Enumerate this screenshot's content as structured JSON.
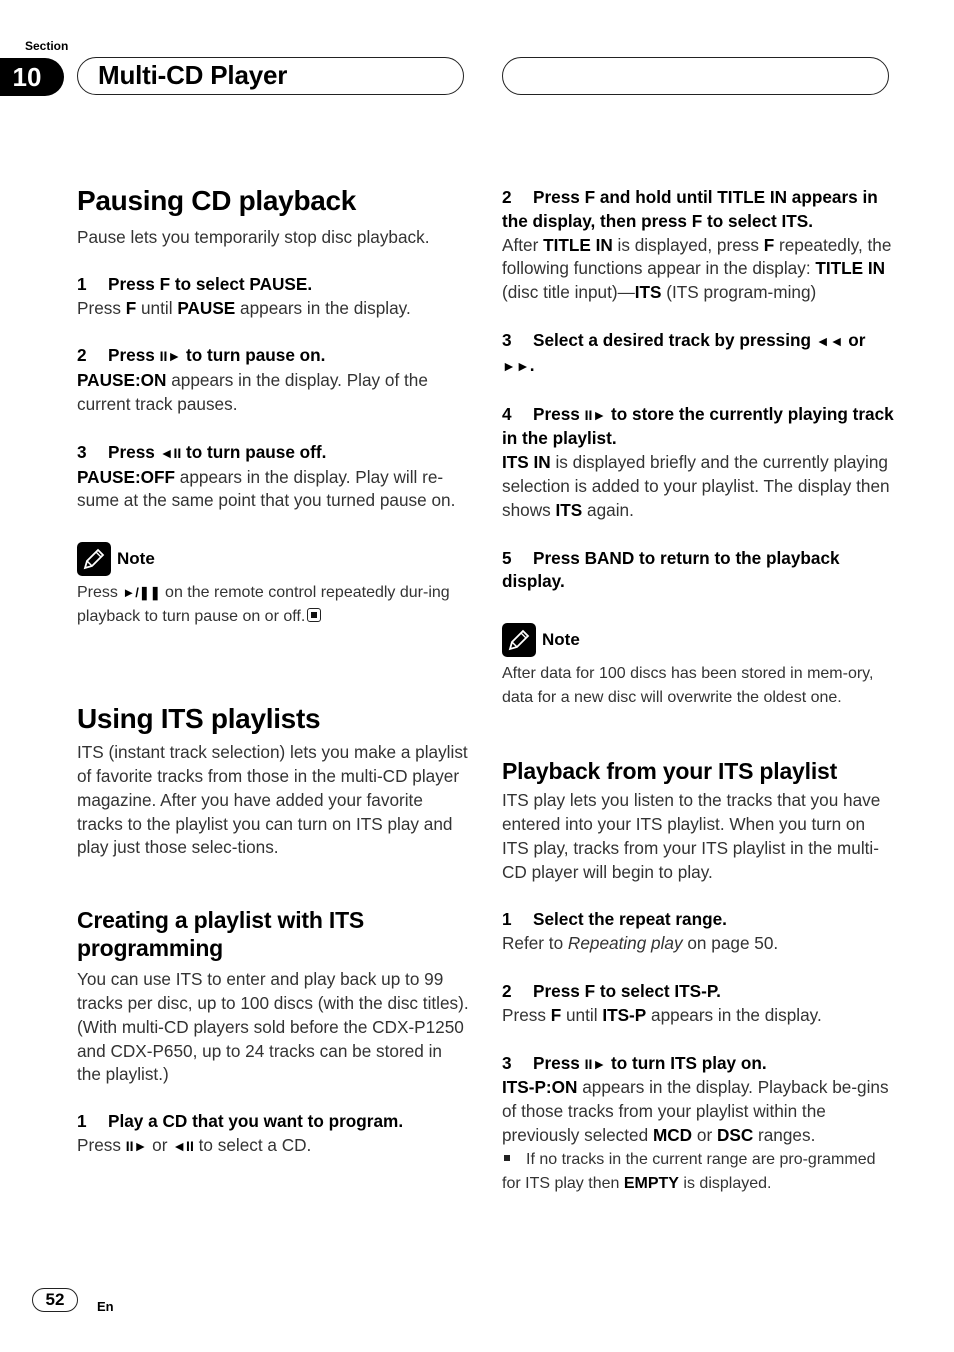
{
  "header": {
    "section_label": "Section",
    "section_number": "10",
    "title": "Multi-CD Player"
  },
  "left": {
    "pausing": {
      "title": "Pausing CD playback",
      "intro": "Pause lets you temporarily stop disc playback.",
      "step1": {
        "num": "1",
        "title": "Press F to select PAUSE.",
        "b_pre": "Press ",
        "b1": "F",
        "b_mid": " until ",
        "b2": "PAUSE",
        "b_post": " appears in the display."
      },
      "step2": {
        "num": "2",
        "t_pre": "Press ",
        "icon": "II►",
        "t_post": " to turn pause on.",
        "b1": "PAUSE:ON",
        "b_post": " appears in the display. Play of the current track pauses."
      },
      "step3": {
        "num": "3",
        "t_pre": "Press ",
        "icon": "◄II",
        "t_post": " to turn pause off.",
        "b1": "PAUSE:OFF",
        "b_post": " appears in the display. Play will re-sume at the same point that you turned pause on."
      },
      "note": {
        "label": "Note",
        "pre": "Press ",
        "icon": "►/❚❚",
        "post": " on the remote control repeatedly dur-ing playback to turn pause on or off."
      }
    },
    "its": {
      "title": "Using ITS playlists",
      "intro": "ITS (instant track selection) lets you make a playlist of favorite tracks from those in the multi-CD player magazine. After you have added your favorite tracks to the playlist you can turn on ITS play and play just those selec-tions."
    },
    "creating": {
      "title": "Creating a playlist with ITS programming",
      "intro": "You can use ITS to enter and play back up to 99 tracks per disc, up to 100 discs (with the disc titles). (With multi-CD players sold before the CDX-P1250 and CDX-P650, up to 24 tracks can be stored in the playlist.)",
      "step1": {
        "num": "1",
        "title": "Play a CD that you want to program.",
        "pre": "Press ",
        "icon1": "II►",
        "mid": " or ",
        "icon2": "◄II",
        "post": " to select a CD."
      }
    }
  },
  "right": {
    "step2": {
      "num": "2",
      "title": "Press F and hold until TITLE IN appears in the display, then press F to select ITS.",
      "p1": "After ",
      "b1": "TITLE IN",
      "p2": " is displayed, press ",
      "b2": "F",
      "p3": " repeatedly, the following functions appear in the display: ",
      "b3": "TITLE IN",
      "p4": " (disc title input)—",
      "b4": "ITS",
      "p5": " (ITS program-ming)"
    },
    "step3": {
      "num": "3",
      "t_pre": "Select a desired track by pressing ",
      "icon1": "◄◄",
      "t_mid": " or ",
      "icon2": "►►",
      "t_post": "."
    },
    "step4": {
      "num": "4",
      "t_pre": "Press ",
      "icon": "II►",
      "t_post": " to store the currently playing track in the playlist.",
      "b1": "ITS IN",
      "p1": " is displayed briefly and the currently playing selection is added to your playlist. The display then shows ",
      "b2": "ITS",
      "p2": " again."
    },
    "step5": {
      "num": "5",
      "title": "Press BAND to return to the playback display."
    },
    "note": {
      "label": "Note",
      "text": "After data for 100 discs has been stored in mem-ory, data for a new disc will overwrite the oldest one."
    },
    "playback": {
      "title": "Playback from your ITS playlist",
      "intro": "ITS play lets you listen to the tracks that you have entered into your ITS playlist. When you turn on ITS play, tracks from your ITS playlist in the multi-CD player will begin to play.",
      "step1": {
        "num": "1",
        "title": "Select the repeat range.",
        "pre": "Refer to ",
        "italic": "Repeating play",
        "post": " on page 50."
      },
      "step2": {
        "num": "2",
        "title": "Press F to select ITS-P.",
        "pre": "Press ",
        "b1": "F",
        "mid": " until ",
        "b2": "ITS-P",
        "post": " appears in the display."
      },
      "step3": {
        "num": "3",
        "t_pre": "Press ",
        "icon": "II►",
        "t_post": " to turn ITS play on.",
        "b1": "ITS-P:ON",
        "p1": " appears in the display. Playback be-gins of those tracks from your playlist within the previously selected ",
        "b2": "MCD",
        "p2": " or ",
        "b3": "DSC",
        "p3": " ranges.",
        "bullet_pre": "If no tracks in the current range are pro-grammed for ITS play then ",
        "bullet_b": "EMPTY",
        "bullet_post": " is displayed."
      }
    }
  },
  "footer": {
    "page_number": "52",
    "language": "En"
  }
}
